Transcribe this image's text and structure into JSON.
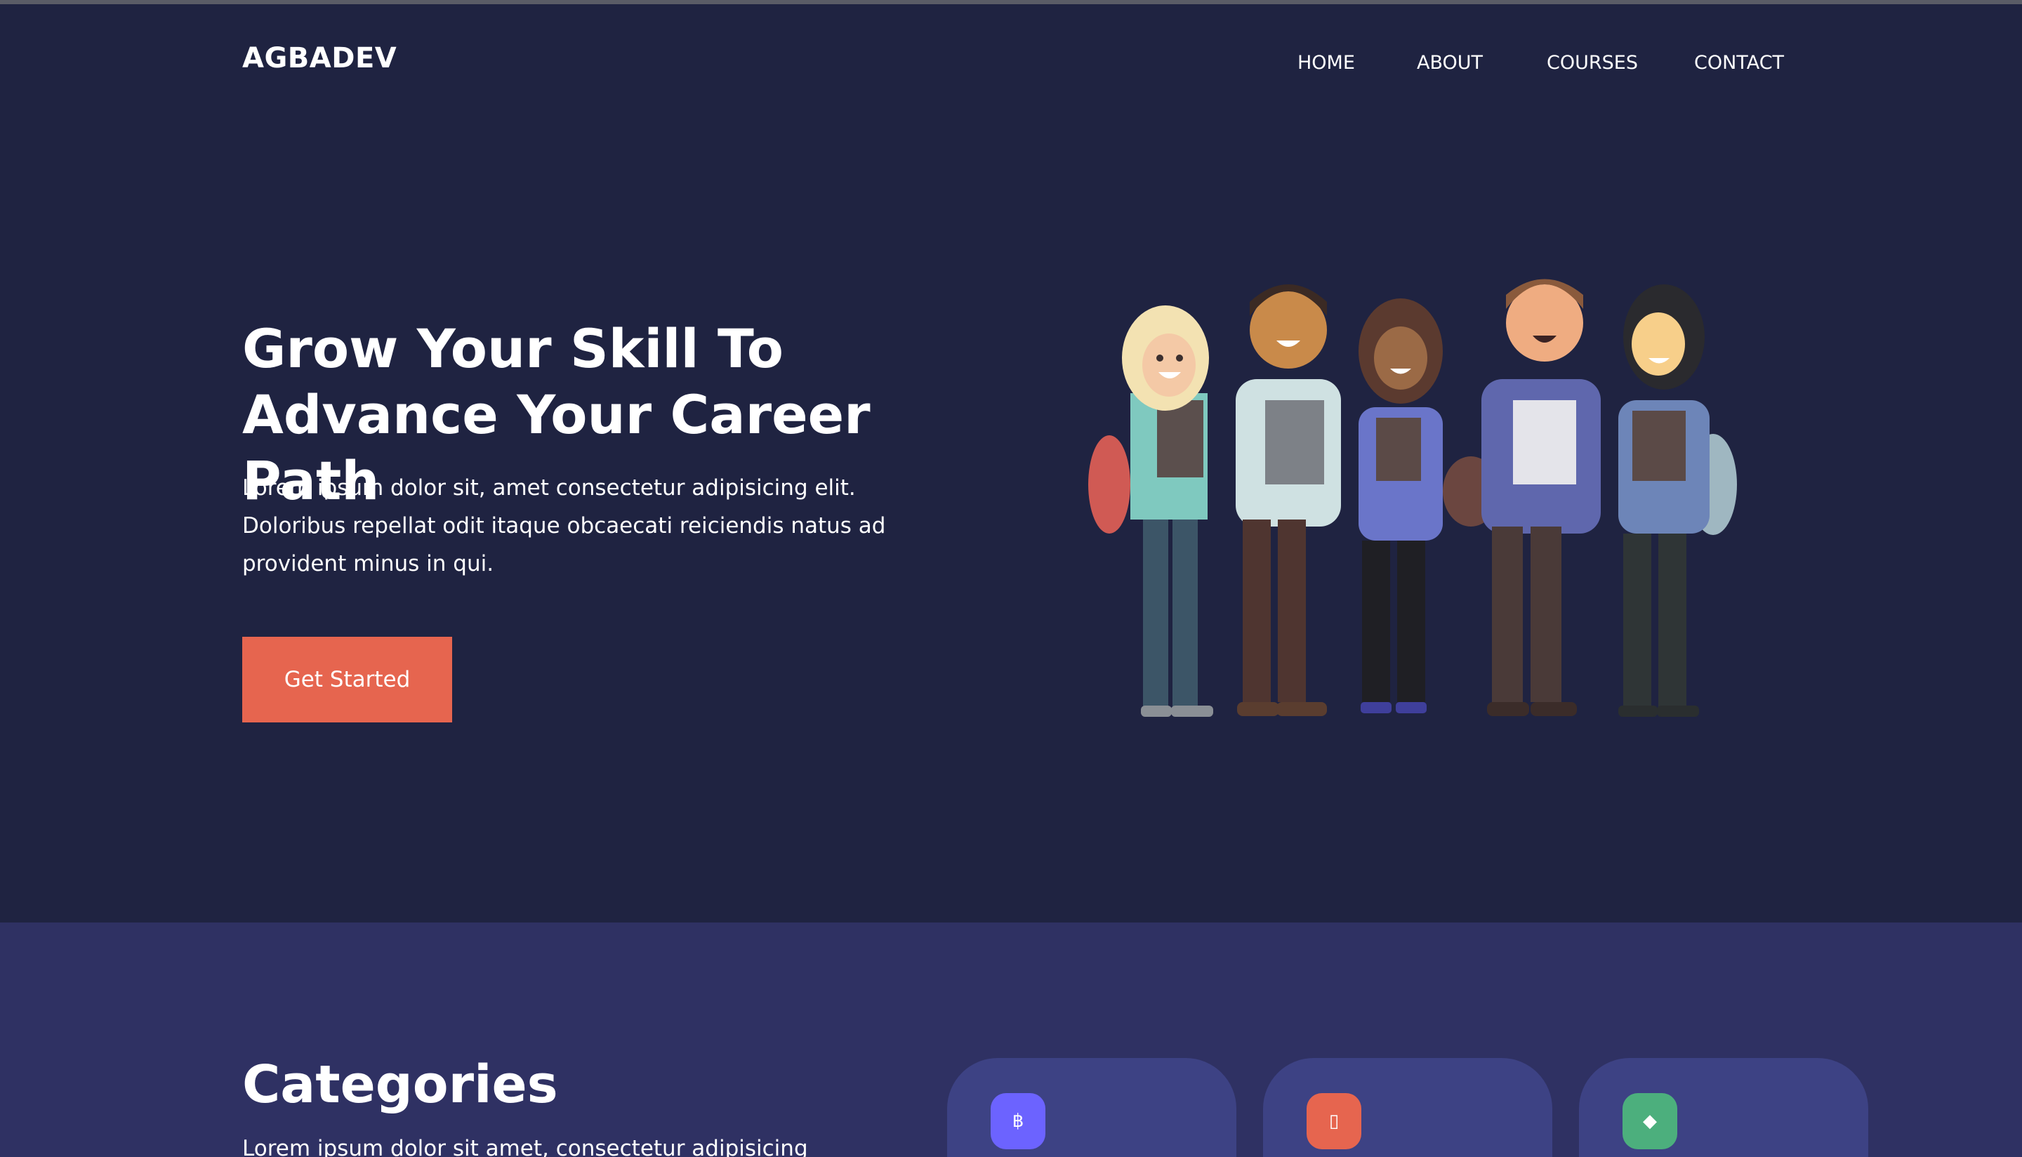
{
  "brand": {
    "logo": "AGBADEV"
  },
  "nav": {
    "items": [
      "HOME",
      "ABOUT",
      "COURSES",
      "CONTACT"
    ]
  },
  "hero": {
    "title": "Grow Your Skill To Advance Your Career Path",
    "text": "Lorem ipsum dolor sit, amet consectetur adipisicing elit. Doloribus repellat odit itaque obcaecati reiciendis natus ad provident minus in qui.",
    "cta_label": "Get Started",
    "illustration": "group-of-students-illustration"
  },
  "categories": {
    "title": "Categories",
    "text": "Lorem ipsum dolor sit amet, consectetur adipisicing",
    "cards": [
      {
        "icon": "bitcoin-icon",
        "glyph": "฿",
        "color": "#6c63ff"
      },
      {
        "icon": "mobile-icon",
        "glyph": "▯",
        "color": "#e6654f"
      },
      {
        "icon": "diamond-icon",
        "glyph": "◆",
        "color": "#4caf7d"
      }
    ]
  },
  "colors": {
    "hero_bg": "#1f2341",
    "section_bg": "#2f3163",
    "card_bg": "#3d4284",
    "accent": "#e6654f"
  }
}
